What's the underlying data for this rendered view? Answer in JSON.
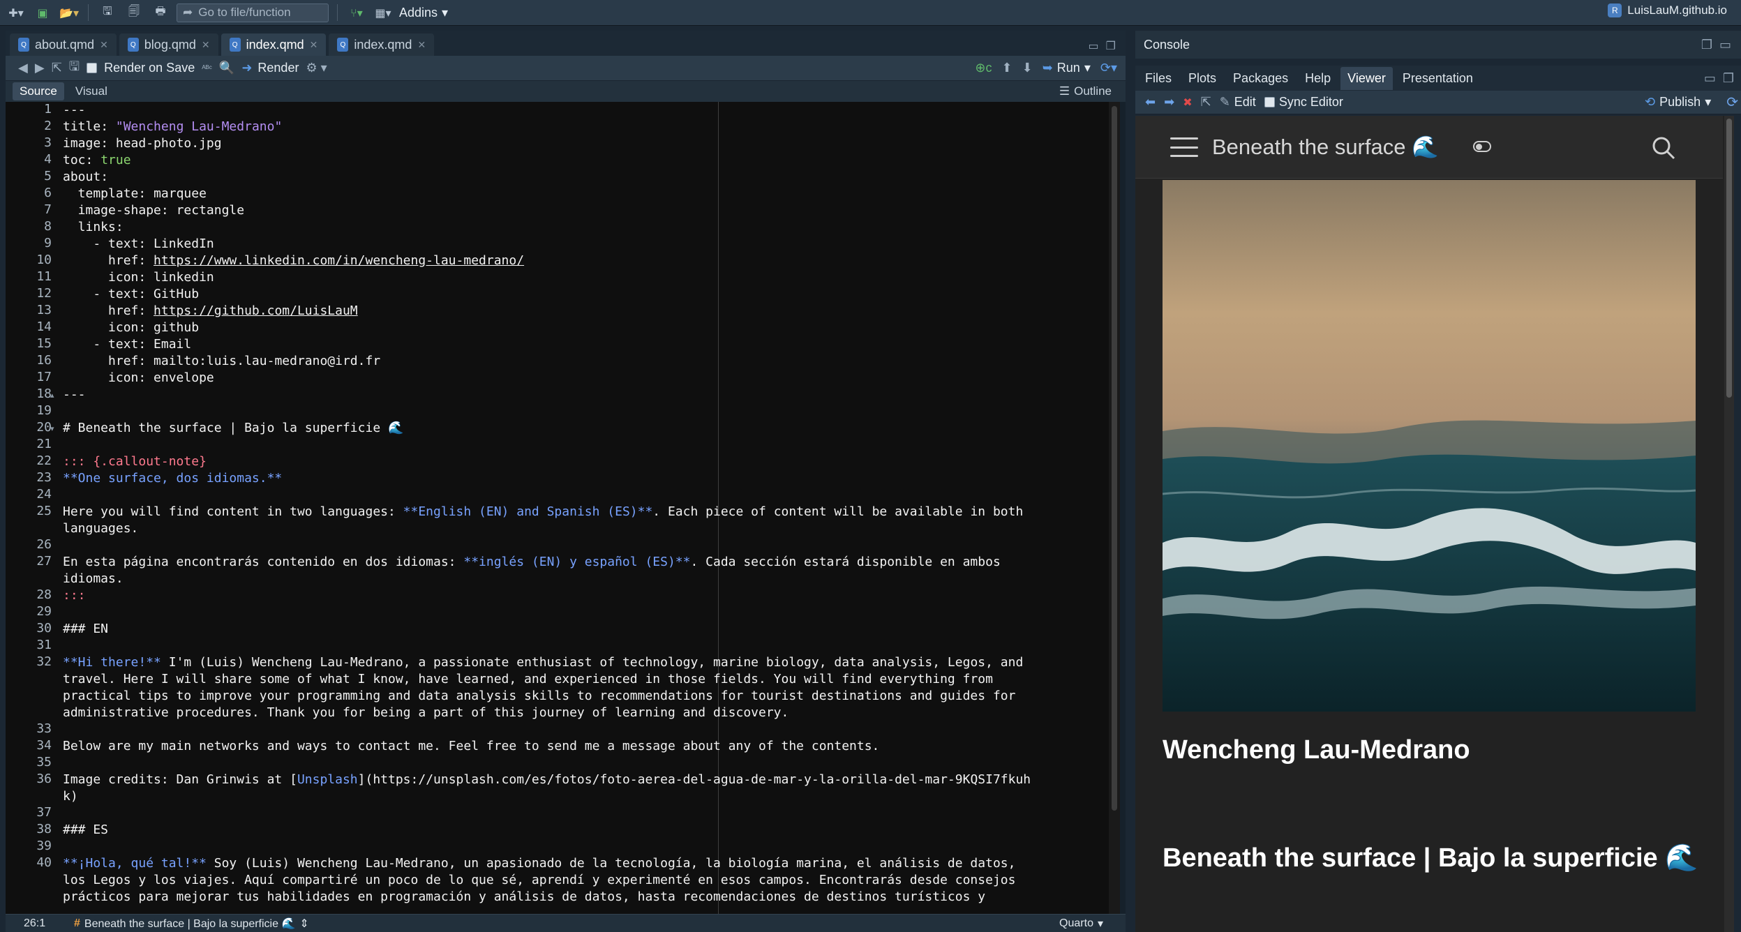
{
  "toolbar": {
    "goto_placeholder": "Go to file/function",
    "addins_label": "Addins",
    "project_name": "LuisLauM.github.io"
  },
  "tabs": [
    {
      "label": "about.qmd"
    },
    {
      "label": "blog.qmd"
    },
    {
      "label": "index.qmd"
    },
    {
      "label": "index.qmd"
    }
  ],
  "editor_toolbar": {
    "render_on_save": "Render on Save",
    "render": "Render",
    "run": "Run"
  },
  "modes": {
    "source": "Source",
    "visual": "Visual",
    "outline": "Outline"
  },
  "line_numbers": [
    "1",
    "2",
    "3",
    "4",
    "5",
    "6",
    "7",
    "8",
    "9",
    "10",
    "11",
    "12",
    "13",
    "14",
    "15",
    "16",
    "17",
    "18",
    "19",
    "20",
    "21",
    "22",
    "23",
    "24",
    "25",
    "",
    "26",
    "27",
    "",
    "28",
    "29",
    "30",
    "31",
    "32",
    "",
    "",
    "",
    "33",
    "34",
    "35",
    "36",
    "",
    "37",
    "38",
    "39",
    "40",
    "",
    ""
  ],
  "code": {
    "l1": "---",
    "l2_key": "title",
    "l2_val": "\"Wencheng Lau-Medrano\"",
    "l3_key": "image",
    "l3_val": "head-photo.jpg",
    "l4_key": "toc",
    "l4_val": "true",
    "l5_key": "about",
    "l6_key": "  template",
    "l6_val": "marquee",
    "l7_key": "  image-shape",
    "l7_val": "rectangle",
    "l8_key": "  links",
    "l9_pre": "    - text: ",
    "l9_val": "LinkedIn",
    "l10_pre": "      href: ",
    "l10_val": "https://www.linkedin.com/in/wencheng-lau-medrano/",
    "l11_pre": "      icon: ",
    "l11_val": "linkedin",
    "l12_pre": "    - text: ",
    "l12_val": "GitHub",
    "l13_pre": "      href: ",
    "l13_val": "https://github.com/LuisLauM",
    "l14_pre": "      icon: ",
    "l14_val": "github",
    "l15_pre": "    - text: ",
    "l15_val": "Email",
    "l16_pre": "      href: ",
    "l16_val": "mailto:luis.lau-medrano@ird.fr",
    "l17_pre": "      icon: ",
    "l17_val": "envelope",
    "l18": "---",
    "l20": "# Beneath the surface | Bajo la superficie 🌊",
    "l22": "::: {.callout-note}",
    "l23": "**One surface, dos idiomas.**",
    "l25a_pre": "Here you will find content in two languages: ",
    "l25a_bold": "**English (EN) and Spanish (ES)**",
    "l25a_post": ". Each piece of content will be available in both",
    "l25b": "languages.",
    "l27a_pre": "En esta página encontrarás contenido en dos idiomas: ",
    "l27a_bold": "**inglés (EN) y español (ES)**",
    "l27a_post": ". Cada sección estará disponible en ambos",
    "l27b": "idiomas.",
    "l28": ":::",
    "l30": "### EN",
    "l32a_bold": "**Hi there!**",
    "l32a_post": " I'm (Luis) Wencheng Lau-Medrano, a passionate enthusiast of technology, marine biology, data analysis, Legos, and",
    "l32b": "travel. Here I will share some of what I know, have learned, and experienced in those fields. You will find everything from",
    "l32c": "practical tips to improve your programming and data analysis skills to recommendations for tourist destinations and guides for",
    "l32d": "administrative procedures. Thank you for being a part of this journey of learning and discovery.",
    "l34": "Below are my main networks and ways to contact me. Feel free to send me a message about any of the contents.",
    "l36a_pre": "Image credits: Dan Grinwis at [",
    "l36a_link": "Unsplash",
    "l36a_post": "](https://unsplash.com/es/fotos/foto-aerea-del-agua-de-mar-y-la-orilla-del-mar-9KQSI7fkuh",
    "l36b": "k)",
    "l38": "### ES",
    "l40a_bold": "**¡Hola, qué tal!**",
    "l40a_post": " Soy (Luis) Wencheng Lau-Medrano, un apasionado de la tecnología, la biología marina, el análisis de datos,",
    "l40b": "los Legos y los viajes. Aquí compartiré un poco de lo que sé, aprendí y experimenté en esos campos. Encontrarás desde consejos",
    "l40c": "prácticos para mejorar tus habilidades en programación y análisis de datos, hasta recomendaciones de destinos turísticos y"
  },
  "status": {
    "position": "26:1",
    "section": "Beneath the surface | Bajo la superficie 🌊",
    "filetype": "Quarto"
  },
  "console": {
    "title": "Console"
  },
  "viewer_tabs": [
    {
      "label": "Files"
    },
    {
      "label": "Plots"
    },
    {
      "label": "Packages"
    },
    {
      "label": "Help"
    },
    {
      "label": "Viewer"
    },
    {
      "label": "Presentation"
    }
  ],
  "viewer_toolbar": {
    "edit": "Edit",
    "sync_editor": "Sync Editor",
    "publish": "Publish"
  },
  "site": {
    "title": "Beneath the surface 🌊",
    "author": "Wencheng Lau-Medrano",
    "heading": "Beneath the surface | Bajo la superficie 🌊"
  },
  "colors": {
    "string": "#b48ef2",
    "boolean": "#8cd66f",
    "callout": "#ff7a8e",
    "bold_markdown": "#78a2ff",
    "accent": "#4a7fc1"
  }
}
